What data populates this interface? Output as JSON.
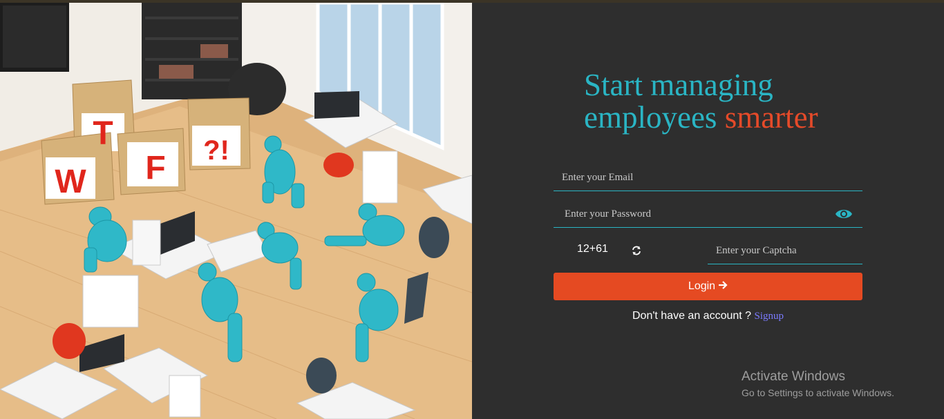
{
  "headline": {
    "line1": "Start managing",
    "line2_prefix": "employees",
    "line2_accent": "smarter"
  },
  "illustration": {
    "blocks": [
      "T",
      "W",
      "F",
      "?!"
    ]
  },
  "form": {
    "email_placeholder": "Enter your Email",
    "password_placeholder": "Enter your Password",
    "captcha_question": "12+61",
    "captcha_placeholder": "Enter your Captcha",
    "login_label": "Login",
    "signup_prompt": "Don't have an account ?",
    "signup_link": "Signup"
  },
  "watermark": {
    "title": "Activate Windows",
    "subtitle": "Go to Settings to activate Windows."
  },
  "colors": {
    "accent_teal": "#2ab5c4",
    "accent_orange": "#e54a22",
    "panel_bg": "#2e2e2e",
    "link": "#7b7bff"
  },
  "icons": {
    "password_toggle": "eye-icon",
    "captcha_refresh": "refresh-icon",
    "login_arrow": "arrow-right-icon"
  }
}
